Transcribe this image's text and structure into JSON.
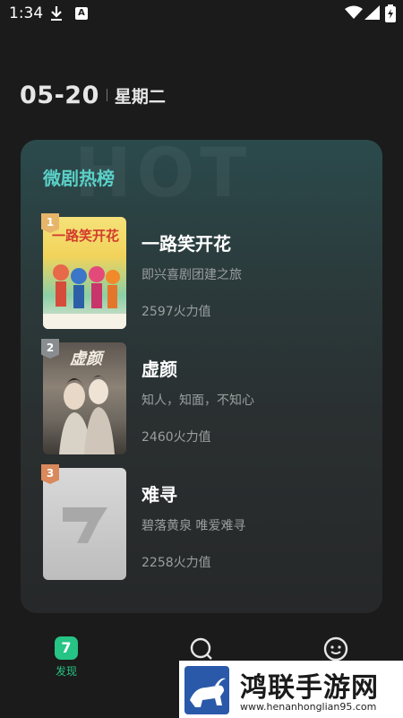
{
  "status_bar": {
    "time": "1:34",
    "notification_letter": "A"
  },
  "date": {
    "day": "05-20",
    "weekday": "星期二"
  },
  "card": {
    "watermark": "HOT",
    "title": "微剧热榜",
    "items": [
      {
        "rank": "1",
        "title": "一路笑开花",
        "subtitle": "即兴喜剧团建之旅",
        "heat": "2597火力值",
        "badge_color": "#e7b56a",
        "poster_text": "一路笑开花"
      },
      {
        "rank": "2",
        "title": "虚颜",
        "subtitle": "知人，知面，不知心",
        "heat": "2460火力值",
        "badge_color": "#8a8d90",
        "poster_text": "虚颜"
      },
      {
        "rank": "3",
        "title": "难寻",
        "subtitle": "碧落黄泉 唯爱难寻",
        "heat": "2258火力值",
        "badge_color": "#d9895b",
        "poster_text": ""
      }
    ]
  },
  "bottom_nav": {
    "discover_label": "发现",
    "discover_icon_glyph": "7",
    "active_color": "#26c485"
  },
  "banner": {
    "title": "鸿联手游网",
    "url": "www.henanhonglian95.com"
  }
}
